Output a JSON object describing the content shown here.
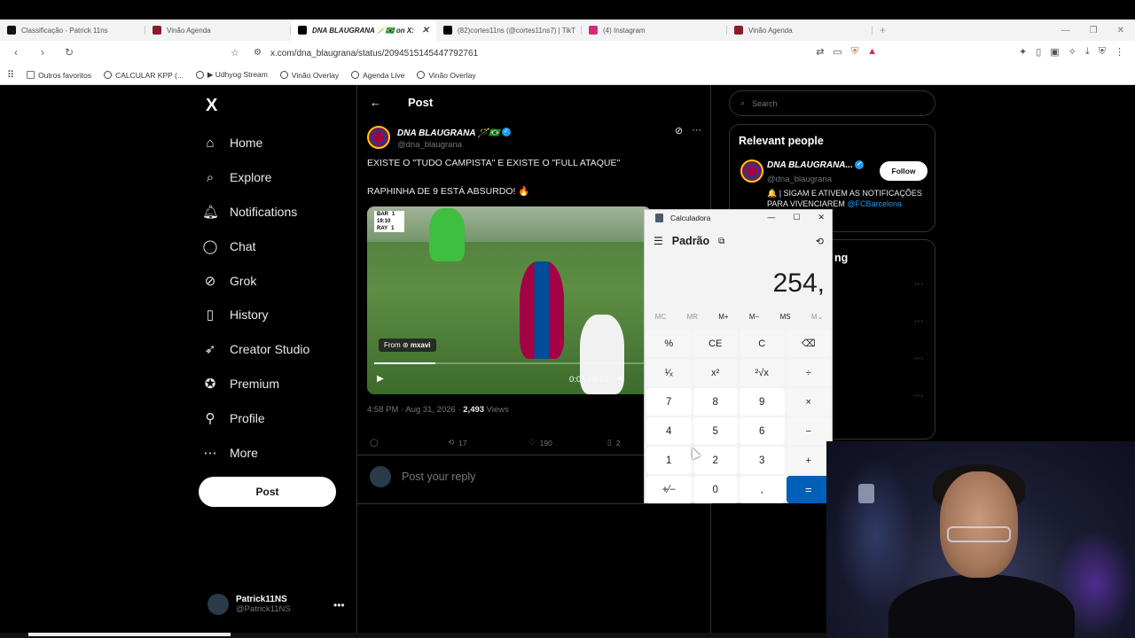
{
  "browser": {
    "tabs": [
      {
        "title": "Classificação - Patrick 11ns",
        "color": "#111111"
      },
      {
        "title": "Vinão Agenda",
        "color": "#8b1a2b"
      },
      {
        "title": "DNA BLAUGRANA 🪄🇧🇷 on X:",
        "color": "#000000"
      },
      {
        "title": "(82)cortes11ns (@cortes11ns7) | TikT",
        "color": "#000000"
      },
      {
        "title": "(4) Instagram",
        "color": "#d62976"
      },
      {
        "title": "Vinão Agenda",
        "color": "#8b1a2b"
      }
    ],
    "url": "x.com/dna_blaugrana/status/2094515145447792761",
    "bookmarks": [
      "Outros favoritos",
      "CALCULAR KPP (...",
      "▶ Udhyog Stream",
      "Vinão Overlay",
      "Agenda Live",
      "Vinão Overlay"
    ]
  },
  "x": {
    "logo": "X",
    "nav": [
      {
        "label": "Home",
        "icon": "home-icon",
        "glyph": "⌂",
        "dot": false
      },
      {
        "label": "Explore",
        "icon": "search-icon",
        "glyph": "⌕",
        "dot": false
      },
      {
        "label": "Notifications",
        "icon": "bell-icon",
        "glyph": "🔔︎",
        "dot": false
      },
      {
        "label": "Chat",
        "icon": "chat-icon",
        "glyph": "◯",
        "dot": false
      },
      {
        "label": "Grok",
        "icon": "grok-icon",
        "glyph": "⊘",
        "dot": true
      },
      {
        "label": "History",
        "icon": "bookmark-icon",
        "glyph": "▯",
        "dot": false
      },
      {
        "label": "Creator Studio",
        "icon": "rocket-icon",
        "glyph": "➶",
        "dot": false
      },
      {
        "label": "Premium",
        "icon": "verified-icon",
        "glyph": "✪",
        "dot": false
      },
      {
        "label": "Profile",
        "icon": "person-icon",
        "glyph": "⚲",
        "dot": false
      },
      {
        "label": "More",
        "icon": "more-circle-icon",
        "glyph": "⋯",
        "dot": false
      }
    ],
    "post_button": "Post",
    "me": {
      "name": "Patrick11NS",
      "handle": "@Patrick11NS"
    },
    "header_title": "Post",
    "tweet": {
      "author": "DNA BLAUGRANA 🪄🇧🇷",
      "handle": "@dna_blaugrana",
      "line1": "EXISTE O \"TUDO CAMPISTA\" E EXISTE O \"FULL ATAQUE\"",
      "line2": "RAPHINHA DE 9 ESTÁ ABSURDO! 🔥",
      "video": {
        "from": "From",
        "source": "mxavi",
        "time": "0:01 / 0:07",
        "progress": 0.22,
        "score": {
          "home": "BAR",
          "home_score": "1",
          "away": "RAY",
          "away_score": "1",
          "clock": "19:10"
        }
      },
      "time": "4:58 PM · Aug 31, 2026 · ",
      "views_count": "2,493",
      "views_label": " Views",
      "retweets": "17",
      "likes": "190",
      "bookmarks": "2"
    },
    "reply_placeholder": "Post your reply",
    "search_placeholder": "Search",
    "relevant": {
      "title": "Relevant people",
      "name": "DNA BLAUGRANA...",
      "handle": "@dna_blaugrana",
      "follow": "Follow",
      "bio": "🔔 | SIGAM E ATIVEM AS NOTIFICAÇÕES PARA VIVENCIAREM",
      "mention": "@FCBarcelona"
    },
    "trending_fragment": "ng"
  },
  "calculator": {
    "title": "Calculadora",
    "mode": "Padrão",
    "display": "254,",
    "memory": [
      {
        "label": "MC",
        "enabled": false
      },
      {
        "label": "MR",
        "enabled": false
      },
      {
        "label": "M+",
        "enabled": true
      },
      {
        "label": "M−",
        "enabled": true
      },
      {
        "label": "MS",
        "enabled": true
      },
      {
        "label": "M⌄",
        "enabled": false
      }
    ],
    "keys": [
      {
        "label": "%",
        "kind": "op",
        "name": "percent-key"
      },
      {
        "label": "CE",
        "kind": "op",
        "name": "clear-entry-key"
      },
      {
        "label": "C",
        "kind": "op",
        "name": "clear-key"
      },
      {
        "label": "⌫",
        "kind": "op",
        "name": "backspace-key"
      },
      {
        "label": "¹⁄ₓ",
        "kind": "op",
        "name": "reciprocal-key"
      },
      {
        "label": "x²",
        "kind": "op",
        "name": "square-key"
      },
      {
        "label": "²√x",
        "kind": "op",
        "name": "sqrt-key"
      },
      {
        "label": "÷",
        "kind": "op",
        "name": "divide-key"
      },
      {
        "label": "7",
        "kind": "num",
        "name": "digit-7-key"
      },
      {
        "label": "8",
        "kind": "num",
        "name": "digit-8-key"
      },
      {
        "label": "9",
        "kind": "num",
        "name": "digit-9-key"
      },
      {
        "label": "×",
        "kind": "op",
        "name": "multiply-key"
      },
      {
        "label": "4",
        "kind": "num",
        "name": "digit-4-key"
      },
      {
        "label": "5",
        "kind": "num",
        "name": "digit-5-key"
      },
      {
        "label": "6",
        "kind": "num",
        "name": "digit-6-key"
      },
      {
        "label": "−",
        "kind": "op",
        "name": "subtract-key"
      },
      {
        "label": "1",
        "kind": "num",
        "name": "digit-1-key"
      },
      {
        "label": "2",
        "kind": "num",
        "name": "digit-2-key"
      },
      {
        "label": "3",
        "kind": "num",
        "name": "digit-3-key"
      },
      {
        "label": "+",
        "kind": "op",
        "name": "add-key"
      },
      {
        "label": "+⁄−",
        "kind": "num",
        "name": "negate-key"
      },
      {
        "label": "0",
        "kind": "num",
        "name": "digit-0-key"
      },
      {
        "label": ",",
        "kind": "num",
        "name": "decimal-key"
      },
      {
        "label": "=",
        "kind": "eq",
        "name": "equals-key"
      }
    ]
  }
}
